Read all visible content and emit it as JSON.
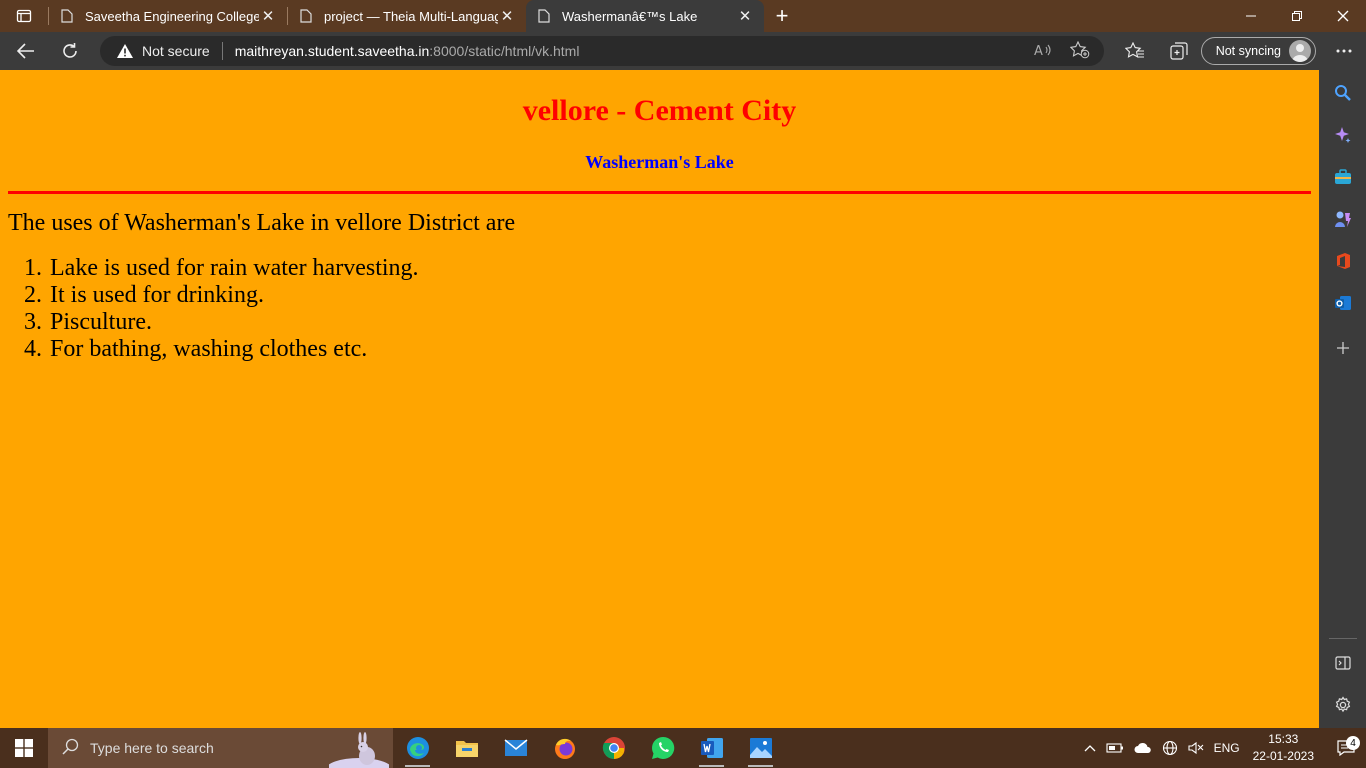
{
  "browser": {
    "tabs": [
      {
        "title": "Saveetha Engineering College",
        "close": "✕",
        "active": false
      },
      {
        "title": "project — Theia Multi-Language",
        "close": "✕",
        "active": false
      },
      {
        "title": "Washermanâ€™s Lake",
        "close": "✕",
        "active": true
      }
    ],
    "new_tab": "+",
    "address": {
      "security_label": "Not secure",
      "host": "maithreyan.student.saveetha.in",
      "path": ":8000/static/html/vk.html"
    },
    "sync_label": "Not syncing"
  },
  "page": {
    "heading": "vellore - Cement City",
    "subheading": "Washerman's Lake",
    "intro": "The uses of Washerman's Lake in vellore District are",
    "uses": [
      "Lake is used for rain water harvesting.",
      "It is used for drinking.",
      "Pisculture.",
      "For bathing, washing clothes etc."
    ],
    "colors": {
      "background": "#ffa500",
      "heading": "#ff0000",
      "subheading": "#0000ff",
      "rule": "#ff0000"
    }
  },
  "taskbar": {
    "search_placeholder": "Type here to search",
    "language": "ENG",
    "time": "15:33",
    "date": "22-01-2023",
    "notification_count": "4"
  }
}
